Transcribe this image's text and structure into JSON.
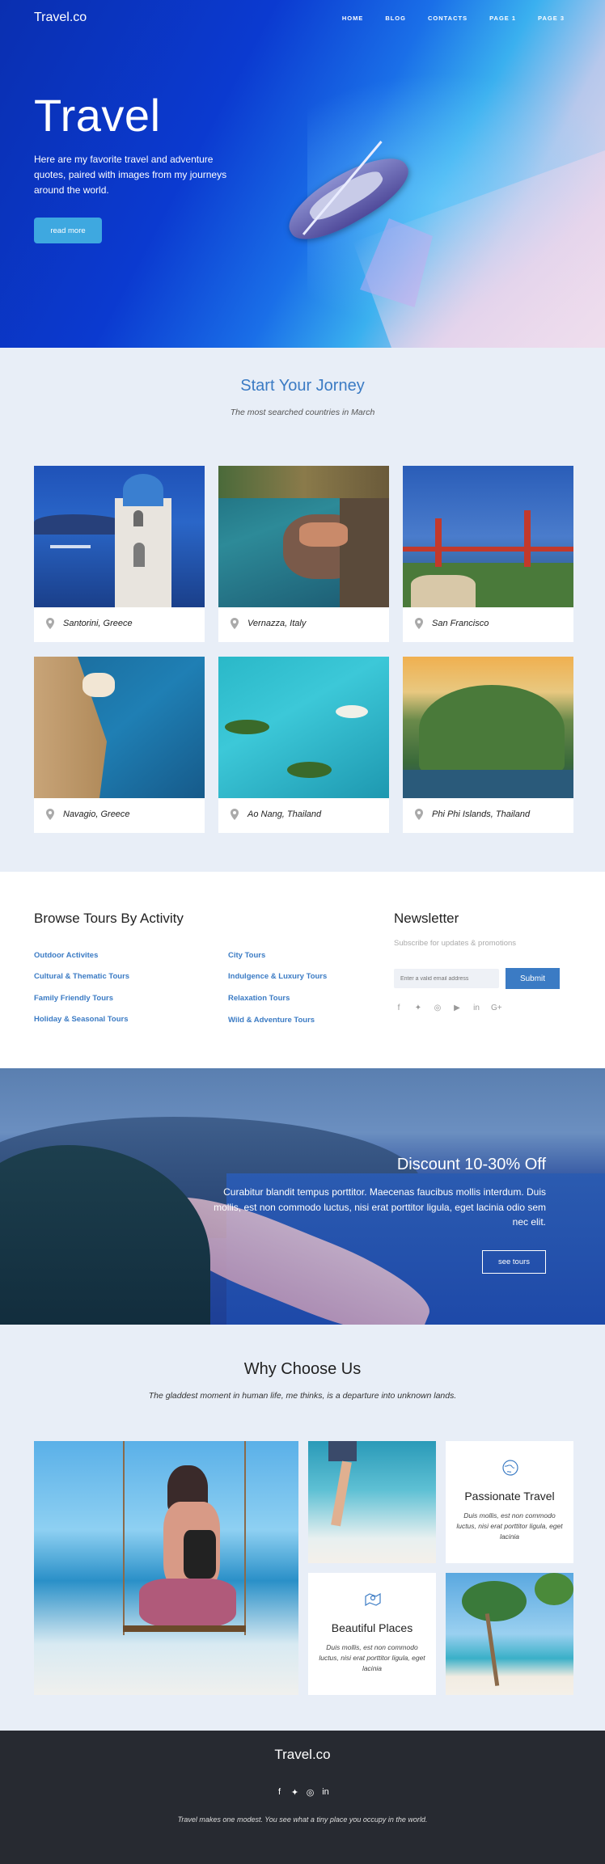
{
  "header": {
    "logo": "Travel.co",
    "nav": [
      "HOME",
      "BLOG",
      "CONTACTS",
      "PAGE 1",
      "PAGE 3"
    ]
  },
  "hero": {
    "title": "Travel",
    "description": "Here are my favorite travel and adventure quotes, paired with images from my journeys around the world.",
    "button": "read more"
  },
  "journey": {
    "title": "Start Your Jorney",
    "subtitle": "The most searched countries in March",
    "destinations": [
      {
        "label": "Santorini, Greece"
      },
      {
        "label": "Vernazza, Italy"
      },
      {
        "label": "San Francisco"
      },
      {
        "label": "Navagio, Greece"
      },
      {
        "label": "Ao Nang, Thailand"
      },
      {
        "label": "Phi Phi Islands, Thailand"
      }
    ]
  },
  "browse": {
    "title": "Browse Tours By Activity",
    "col1": [
      "Outdoor Activites",
      "Cultural & Thematic Tours",
      "Family Friendly Tours",
      "Holiday & Seasonal Tours"
    ],
    "col2": [
      "City Tours",
      "Indulgence & Luxury Tours",
      "Relaxation Tours",
      "Wild & Adventure Tours"
    ]
  },
  "newsletter": {
    "title": "Newsletter",
    "subtitle": "Subscribe for updates & promotions",
    "placeholder": "Enter a valid email address",
    "submit": "Submit",
    "social_icons": [
      "facebook-icon",
      "twitter-icon",
      "instagram-icon",
      "youtube-icon",
      "linkedin-icon",
      "google-plus-icon"
    ]
  },
  "discount": {
    "title": "Discount 10-30% Off",
    "description": "Curabitur blandit tempus porttitor. Maecenas faucibus mollis interdum. Duis mollis, est non commodo luctus, nisi erat porttitor ligula, eget lacinia odio sem nec elit.",
    "button": "see tours"
  },
  "why": {
    "title": "Why Choose Us",
    "subtitle": "The gladdest moment in human life, me thinks, is a departure into unknown lands.",
    "features": [
      {
        "title": "Passionate Travel",
        "description": "Duis mollis, est non commodo luctus, nisi erat porttitor ligula, eget lacinia",
        "icon": "globe-icon"
      },
      {
        "title": "Beautiful Places",
        "description": "Duis mollis, est non commodo luctus, nisi erat porttitor ligula, eget lacinia",
        "icon": "map-pin-icon"
      }
    ]
  },
  "footer": {
    "logo": "Travel.co",
    "social_icons": [
      "facebook-icon",
      "twitter-icon",
      "instagram-icon",
      "linkedin-icon"
    ],
    "text": "Travel makes one modest. You see what a tiny place you occupy in the world."
  },
  "colors": {
    "accent": "#3b7bc4",
    "hero_button": "#3ea8e0",
    "footer_bg": "#272a31",
    "section_bg": "#e8eef7"
  }
}
